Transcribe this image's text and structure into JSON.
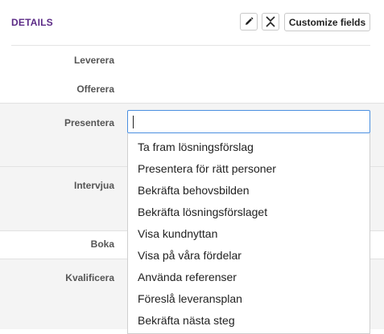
{
  "header": {
    "title": "DETAILS",
    "customize_label": "Customize fields",
    "icons": {
      "edit": "pencil-icon",
      "collapse": "collapse-icon"
    }
  },
  "fields": {
    "leverera": "Leverera",
    "offerera": "Offerera",
    "presentera": "Presentera",
    "intervjua": "Intervjua",
    "boka": "Boka",
    "kvalificera": "Kvalificera"
  },
  "search": {
    "value": "",
    "placeholder": ""
  },
  "options": [
    "Ta fram lösningsförslag",
    "Presentera för rätt personer",
    "Bekräfta behovsbilden",
    "Bekräfta lösningsförslaget",
    "Visa kundnyttan",
    "Visa på våra fördelar",
    "Använda referenser",
    "Föreslå leveransplan",
    "Bekräfta nästa steg"
  ],
  "colors": {
    "title": "#5b2a86",
    "input_focus_border": "#4a8fe0",
    "row_shade": "#f4f4f4"
  }
}
